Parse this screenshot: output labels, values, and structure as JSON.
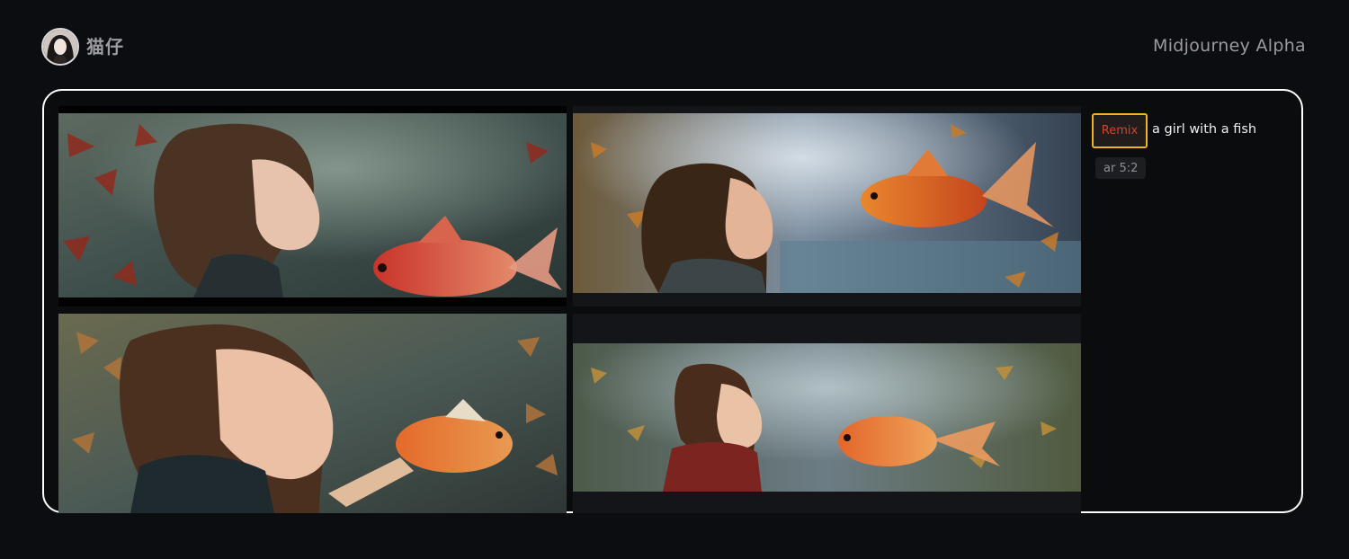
{
  "header": {
    "user_name": "猫仔",
    "app_title": "Midjourney Alpha"
  },
  "job": {
    "images": [
      {
        "label": "generated-image-1"
      },
      {
        "label": "generated-image-2"
      },
      {
        "label": "generated-image-3"
      },
      {
        "label": "generated-image-4"
      }
    ],
    "remix_label": "Remix",
    "prompt": "a girl with a fish",
    "param_badge": "ar 5:2"
  },
  "colors": {
    "background": "#0c0d10",
    "card_border": "#ffffff",
    "remix_highlight": "#f2b321",
    "remix_text": "#d2442f"
  }
}
